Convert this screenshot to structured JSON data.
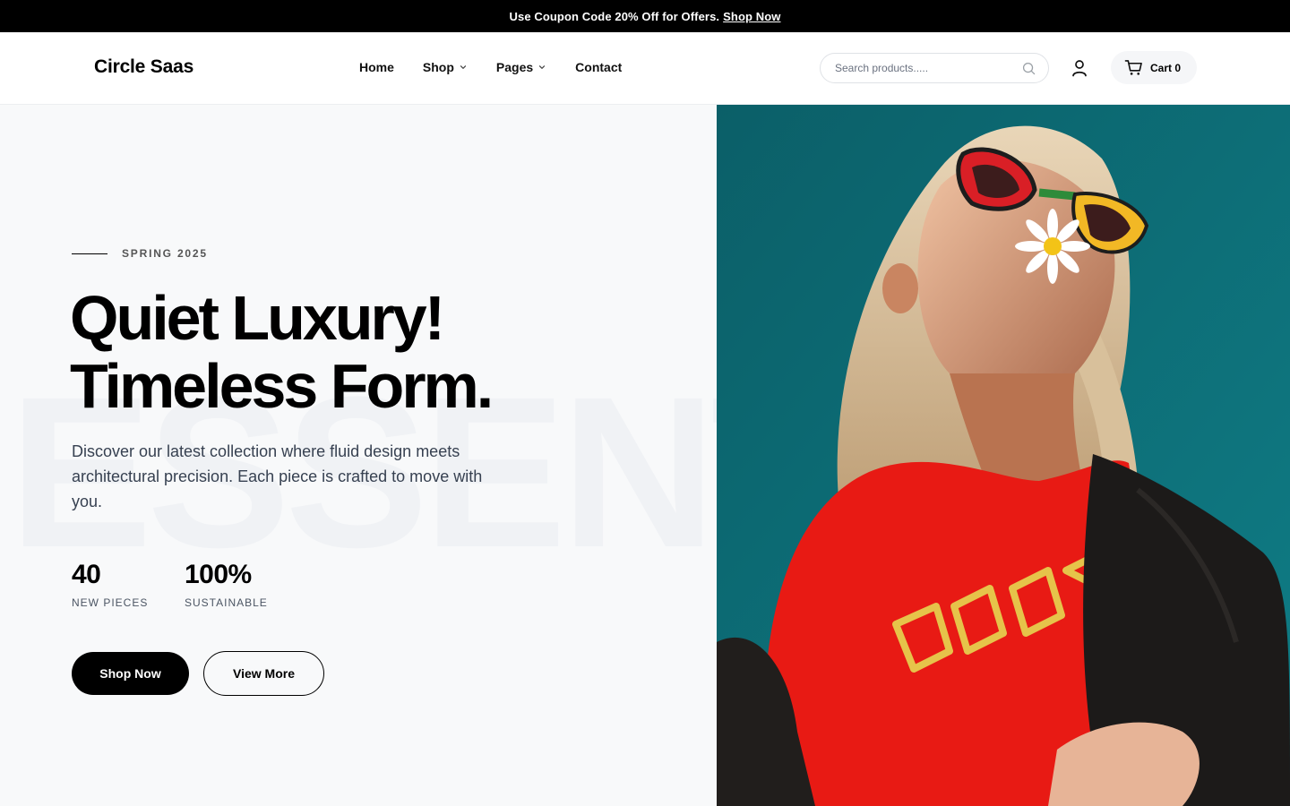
{
  "announcement": {
    "text": "Use Coupon Code 20% Off for Offers.",
    "link": "Shop Now"
  },
  "header": {
    "logo": "Circle Saas",
    "nav": [
      {
        "label": "Home"
      },
      {
        "label": "Shop"
      },
      {
        "label": "Pages"
      },
      {
        "label": "Contact"
      }
    ],
    "search_placeholder": "Search products.....",
    "cart_label": "Cart 0"
  },
  "hero": {
    "eyebrow": "SPRING 2025",
    "headline_line1": "Quiet Luxury!",
    "headline_line2": "Timeless Form.",
    "watermark": "ESSENT",
    "description": "Discover our latest collection where fluid design meets architectural precision. Each piece is crafted to move with you.",
    "stats": [
      {
        "value": "40",
        "label": "NEW PIECES"
      },
      {
        "value": "100%",
        "label": "SUSTAINABLE"
      }
    ],
    "primary_button": "Shop Now",
    "secondary_button": "View More"
  },
  "colors": {
    "accent": "#000000",
    "background": "#f8f9fa",
    "photo_backdrop": "#0d6d78",
    "shirt": "#e81a14"
  },
  "icons": {
    "search": "search-icon",
    "user": "user-icon",
    "cart": "cart-icon",
    "chevron": "chevron-down-icon"
  }
}
